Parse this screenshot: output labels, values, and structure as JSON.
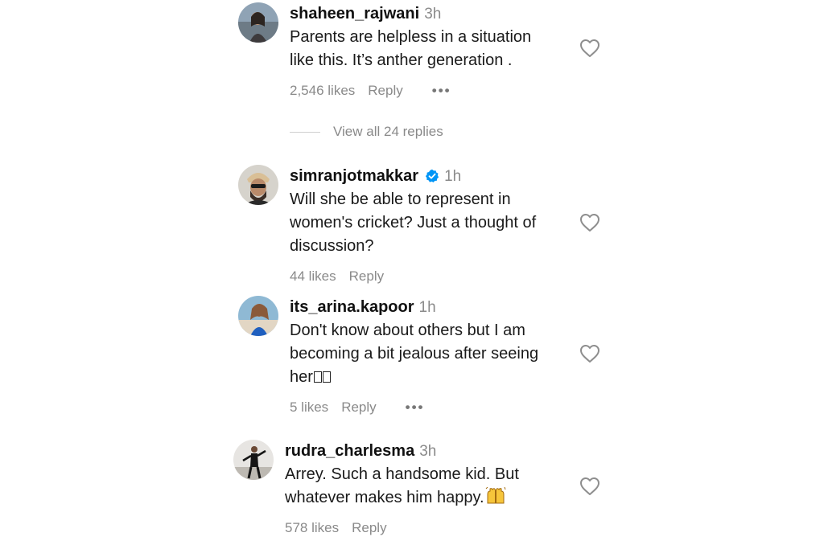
{
  "comments": [
    {
      "username": "shaheen_rajwani",
      "time": "3h",
      "lines": [
        "Parents are helpless in a situation",
        "like this. It’s anther generation ."
      ],
      "likes": "2,546 likes",
      "reply": "Reply",
      "more": "•••",
      "view_replies": "View all 24 replies"
    },
    {
      "username": "simranjotmakkar",
      "verified": true,
      "time": "1h",
      "lines": [
        "Will she be able to represent in",
        "women's cricket? Just a thought of",
        "discussion?"
      ],
      "likes": "44 likes",
      "reply": "Reply"
    },
    {
      "username": "its_arina.kapoor",
      "time": "1h",
      "lines": [
        "Don't know about others but I am",
        "becoming a bit jealous after seeing",
        "her"
      ],
      "emoji": "two unrendered emoji boxes",
      "likes": "5 likes",
      "reply": "Reply",
      "more": "•••"
    },
    {
      "username": "rudra_charlesma",
      "time": "3h",
      "lines": [
        "Arrey. Such a handsome kid. But",
        "whatever makes him happy."
      ],
      "emoji": "raising-hands-emoji",
      "likes": "578 likes",
      "reply": "Reply"
    }
  ],
  "icons": {
    "like": "heart-outline-icon",
    "verified": "verified-badge-icon",
    "more": "more-options-icon"
  },
  "colors": {
    "text": "#111111",
    "secondary": "#8a8a8a",
    "verified": "#0095f6",
    "heart_stroke": "#8e8e8e"
  }
}
